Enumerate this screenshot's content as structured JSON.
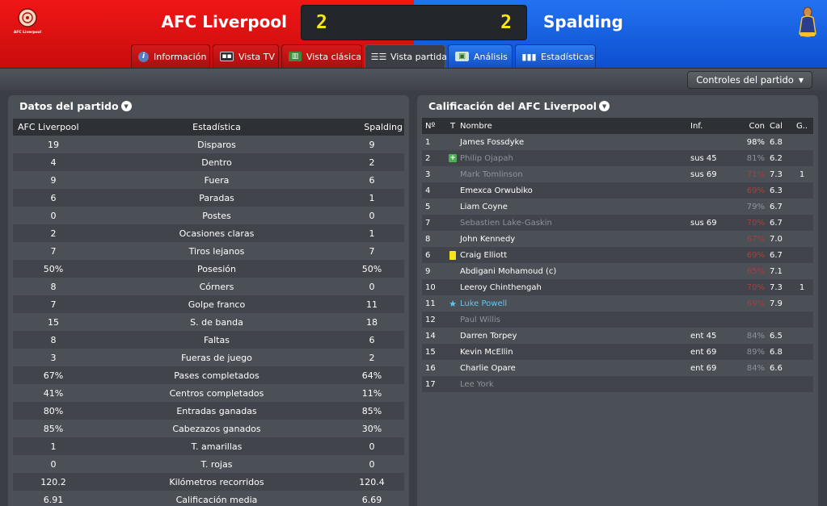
{
  "match": {
    "home_team": "AFC Liverpool",
    "away_team": "Spalding",
    "home_score": "2",
    "away_score": "2",
    "home_crest_text": "AFC Liverpool",
    "home_color": "#e01212",
    "away_color": "#1a62e0",
    "score_color": "#f5e51b"
  },
  "tabs": [
    {
      "label": "Información",
      "icon": "info-icon"
    },
    {
      "label": "Vista TV",
      "icon": "tv-icon"
    },
    {
      "label": "Vista clásica",
      "icon": "pitch-icon"
    },
    {
      "label": "Vista partida",
      "icon": "split-view-icon"
    },
    {
      "label": "Análisis",
      "icon": "analysis-icon"
    },
    {
      "label": "Estadísticas",
      "icon": "bar-chart-icon"
    }
  ],
  "toolbar": {
    "controls_label": "Controles del partido"
  },
  "stats_panel": {
    "title": "Datos del partido",
    "headers": {
      "home": "AFC Liverpool",
      "stat": "Estadística",
      "away": "Spalding"
    },
    "rows": [
      {
        "home": "19",
        "stat": "Disparos",
        "away": "9"
      },
      {
        "home": "4",
        "stat": "Dentro",
        "away": "2"
      },
      {
        "home": "9",
        "stat": "Fuera",
        "away": "6"
      },
      {
        "home": "6",
        "stat": "Paradas",
        "away": "1"
      },
      {
        "home": "0",
        "stat": "Postes",
        "away": "0"
      },
      {
        "home": "2",
        "stat": "Ocasiones claras",
        "away": "1"
      },
      {
        "home": "7",
        "stat": "Tiros lejanos",
        "away": "7"
      },
      {
        "home": "50%",
        "stat": "Posesión",
        "away": "50%"
      },
      {
        "home": "8",
        "stat": "Córners",
        "away": "0"
      },
      {
        "home": "7",
        "stat": "Golpe franco",
        "away": "11"
      },
      {
        "home": "15",
        "stat": "S. de banda",
        "away": "18"
      },
      {
        "home": "8",
        "stat": "Faltas",
        "away": "6"
      },
      {
        "home": "3",
        "stat": "Fueras de juego",
        "away": "2"
      },
      {
        "home": "67%",
        "stat": "Pases completados",
        "away": "64%"
      },
      {
        "home": "41%",
        "stat": "Centros completados",
        "away": "11%"
      },
      {
        "home": "80%",
        "stat": "Entradas ganadas",
        "away": "85%"
      },
      {
        "home": "85%",
        "stat": "Cabezazos ganados",
        "away": "30%"
      },
      {
        "home": "1",
        "stat": "T. amarillas",
        "away": "0"
      },
      {
        "home": "0",
        "stat": "T. rojas",
        "away": "0"
      },
      {
        "home": "120.2",
        "stat": "Kilómetros recorridos",
        "away": "120.4"
      },
      {
        "home": "6.91",
        "stat": "Calificación media",
        "away": "6.69"
      }
    ]
  },
  "ratings_panel": {
    "title": "Calificación del AFC Liverpool",
    "headers": {
      "num": "Nº",
      "t": "T",
      "name": "Nombre",
      "inf": "Inf.",
      "con": "Con",
      "cal": "Cal",
      "g": "G.."
    },
    "rows": [
      {
        "num": "1",
        "t": "",
        "name": "James Fossdyke",
        "inf": "",
        "con": "98%",
        "cal": "6.8",
        "g": "",
        "state": "normal",
        "con_state": "normal"
      },
      {
        "num": "2",
        "t": "sub-icon",
        "name": "Philip Ojapah",
        "inf": "sus 45",
        "con": "81%",
        "cal": "6.2",
        "g": "",
        "state": "dim",
        "con_state": "dim"
      },
      {
        "num": "3",
        "t": "",
        "name": "Mark Tomlinson",
        "inf": "sus 69",
        "con": "71%",
        "cal": "7.3",
        "g": "1",
        "state": "dim",
        "con_state": "red"
      },
      {
        "num": "4",
        "t": "",
        "name": "Emexca Orwubiko",
        "inf": "",
        "con": "69%",
        "cal": "6.3",
        "g": "",
        "state": "normal",
        "con_state": "red"
      },
      {
        "num": "5",
        "t": "",
        "name": "Liam Coyne",
        "inf": "",
        "con": "79%",
        "cal": "6.7",
        "g": "",
        "state": "normal",
        "con_state": "dim"
      },
      {
        "num": "7",
        "t": "",
        "name": "Sebastien Lake-Gaskin",
        "inf": "sus 69",
        "con": "70%",
        "cal": "6.7",
        "g": "",
        "state": "dim",
        "con_state": "red"
      },
      {
        "num": "8",
        "t": "",
        "name": "John Kennedy",
        "inf": "",
        "con": "67%",
        "cal": "7.0",
        "g": "",
        "state": "normal",
        "con_state": "red"
      },
      {
        "num": "6",
        "t": "yellow-card-icon",
        "name": "Craig Elliott",
        "inf": "",
        "con": "69%",
        "cal": "6.7",
        "g": "",
        "state": "normal",
        "con_state": "red"
      },
      {
        "num": "9",
        "t": "",
        "name": "Abdigani Mohamoud (c)",
        "inf": "",
        "con": "65%",
        "cal": "7.1",
        "g": "",
        "state": "normal",
        "con_state": "red"
      },
      {
        "num": "10",
        "t": "",
        "name": "Leeroy Chinthengah",
        "inf": "",
        "con": "70%",
        "cal": "7.3",
        "g": "1",
        "state": "normal",
        "con_state": "red"
      },
      {
        "num": "11",
        "t": "star-icon",
        "name": "Luke Powell",
        "inf": "",
        "con": "69%",
        "cal": "7.9",
        "g": "",
        "state": "highlight",
        "con_state": "red"
      },
      {
        "num": "12",
        "t": "",
        "name": "Paul Willis",
        "inf": "",
        "con": "",
        "cal": "",
        "g": "",
        "state": "dim",
        "con_state": "dim"
      },
      {
        "num": "14",
        "t": "",
        "name": "Darren Torpey",
        "inf": "ent 45",
        "con": "84%",
        "cal": "6.5",
        "g": "",
        "state": "normal",
        "con_state": "dim"
      },
      {
        "num": "15",
        "t": "",
        "name": "Kevin McEllin",
        "inf": "ent 69",
        "con": "89%",
        "cal": "6.8",
        "g": "",
        "state": "normal",
        "con_state": "dim"
      },
      {
        "num": "16",
        "t": "",
        "name": "Charlie Opare",
        "inf": "ent 69",
        "con": "84%",
        "cal": "6.6",
        "g": "",
        "state": "normal",
        "con_state": "dim"
      },
      {
        "num": "17",
        "t": "",
        "name": "Lee York",
        "inf": "",
        "con": "",
        "cal": "",
        "g": "",
        "state": "dim",
        "con_state": "dim"
      }
    ]
  }
}
